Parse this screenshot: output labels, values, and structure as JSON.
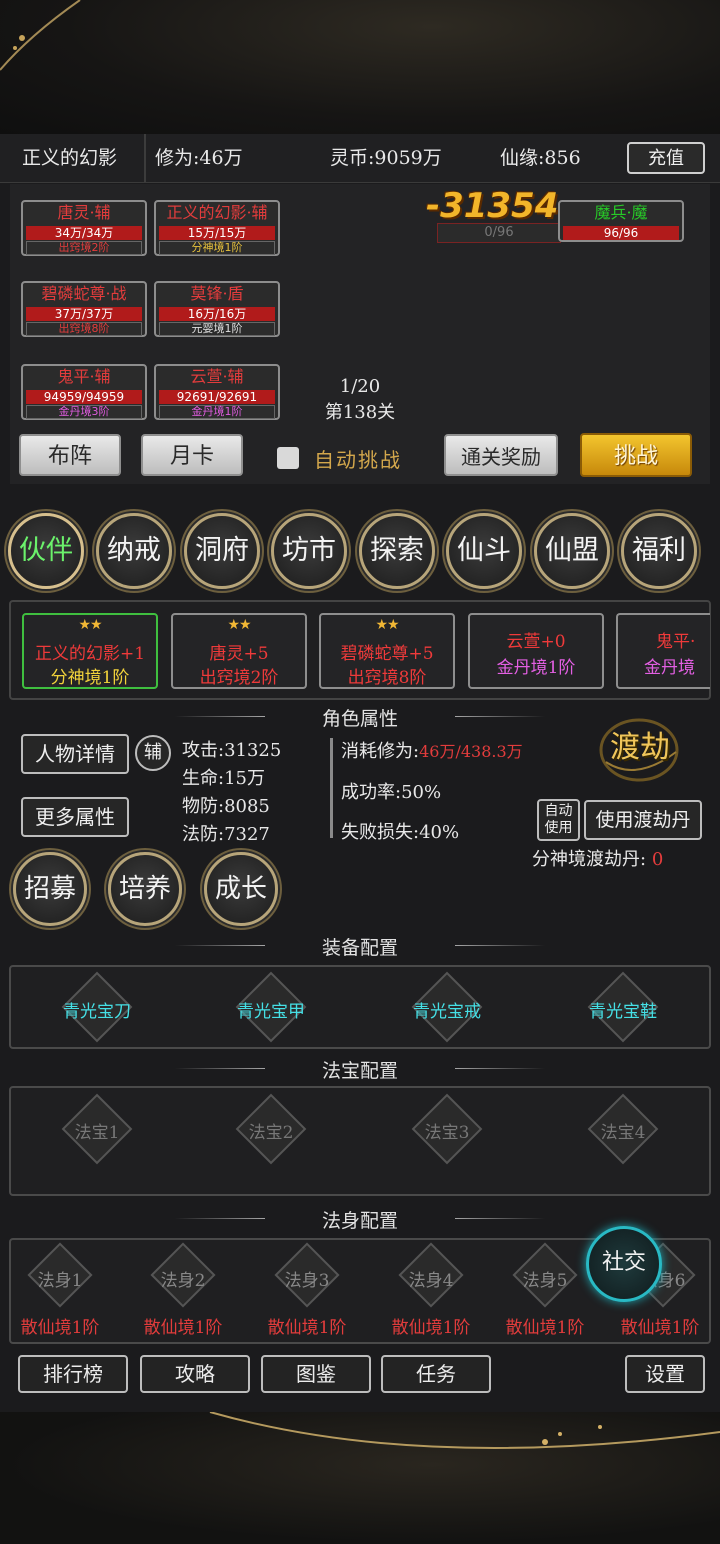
{
  "topbar": {
    "player_name": "正义的幻影",
    "cultivation": "修为:46万",
    "spirit_coin": "灵币:9059万",
    "fate": "仙缘:856",
    "recharge": "充值"
  },
  "battle": {
    "allies": [
      {
        "name": "唐灵·辅",
        "hp": "34万/34万",
        "rank": "出窍境2阶",
        "rank_color": "#e23c3c"
      },
      {
        "name": "正义的幻影·辅",
        "hp": "15万/15万",
        "rank": "分神境1阶",
        "rank_color": "#e6c13c"
      },
      {
        "name": "碧磷蛇尊·战",
        "hp": "37万/37万",
        "rank": "出窍境8阶",
        "rank_color": "#e23c3c"
      },
      {
        "name": "莫锋·盾",
        "hp": "16万/16万",
        "rank": "元婴境1阶",
        "rank_color": "#e0e0e0"
      },
      {
        "name": "鬼平·辅",
        "hp": "94959/94959",
        "rank": "金丹境3阶",
        "rank_color": "#e05ce0"
      },
      {
        "name": "云萱·辅",
        "hp": "92691/92691",
        "rank": "金丹境1阶",
        "rank_color": "#e05ce0"
      }
    ],
    "enemy": {
      "name": "魔兵·魔",
      "hp": "96/96"
    },
    "damage": "-31354",
    "enemy_bar": "0/96",
    "wave": "1/20",
    "stage": "第138关",
    "buttons": {
      "formation": "布阵",
      "monthly_card": "月卡",
      "auto_challenge": "自动挑战",
      "clear_reward": "通关奖励",
      "challenge": "挑战"
    }
  },
  "menu": [
    "伙伴",
    "纳戒",
    "洞府",
    "坊市",
    "探索",
    "仙斗",
    "仙盟",
    "福利"
  ],
  "partners": [
    {
      "stars": "★★",
      "name": "正义的幻影+1",
      "realm": "分神境1阶",
      "realm_color": "#f1d23b",
      "selected": true
    },
    {
      "stars": "★★",
      "name": "唐灵+5",
      "realm": "出窍境2阶",
      "realm_color": "#ef3a3a"
    },
    {
      "stars": "★★",
      "name": "碧磷蛇尊+5",
      "realm": "出窍境8阶",
      "realm_color": "#ef3a3a"
    },
    {
      "stars": "",
      "name": "云萱+0",
      "realm": "金丹境1阶",
      "realm_color": "#e35fe3"
    },
    {
      "stars": "",
      "name": "鬼平·",
      "realm": "金丹境",
      "realm_color": "#e35fe3"
    }
  ],
  "attributes": {
    "title": "角色属性",
    "detail_btn": "人物详情",
    "role_tag": "辅",
    "more_btn": "更多属性",
    "attack": "攻击:31325",
    "life": "生命:15万",
    "phys_def": "物防:8085",
    "magic_def": "法防:7327",
    "cost_label": "消耗修为:",
    "cost_value": "46万/438.3万",
    "success": "成功率:50%",
    "fail_loss": "失败损失:40%",
    "tribulation": "渡劫",
    "auto_use": "自动使用",
    "use_pill": "使用渡劫丹",
    "pill_label": "分神境渡劫丹:",
    "pill_count": "0"
  },
  "actions": [
    "招募",
    "培养",
    "成长"
  ],
  "equipment": {
    "title": "装备配置",
    "items": [
      "青光宝刀",
      "青光宝甲",
      "青光宝戒",
      "青光宝鞋"
    ]
  },
  "treasures": {
    "title": "法宝配置",
    "items": [
      "法宝1",
      "法宝2",
      "法宝3",
      "法宝4"
    ]
  },
  "bodies": {
    "title": "法身配置",
    "items": [
      {
        "slot": "法身1",
        "realm": "散仙境1阶"
      },
      {
        "slot": "法身2",
        "realm": "散仙境1阶"
      },
      {
        "slot": "法身3",
        "realm": "散仙境1阶"
      },
      {
        "slot": "法身4",
        "realm": "散仙境1阶"
      },
      {
        "slot": "法身5",
        "realm": "散仙境1阶"
      },
      {
        "slot": "法身6",
        "realm": "散仙境1阶"
      }
    ]
  },
  "social": "社交",
  "bottom": [
    "排行榜",
    "攻略",
    "图鉴",
    "任务",
    "设置"
  ]
}
